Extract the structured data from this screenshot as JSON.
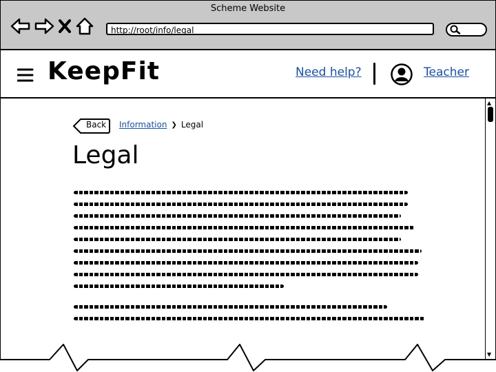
{
  "window": {
    "title": "Scheme Website"
  },
  "browser": {
    "url": "http://root/info/legal",
    "nav": [
      "back-arrow-icon",
      "forward-arrow-icon",
      "stop-icon",
      "home-icon"
    ],
    "search_placeholder": ""
  },
  "header": {
    "logo": "KeepFit",
    "help_link": "Need help?",
    "user_link": "Teacher"
  },
  "page": {
    "back_label": "Back",
    "breadcrumb": {
      "parent": "Information",
      "current": "Legal"
    },
    "title": "Legal"
  }
}
